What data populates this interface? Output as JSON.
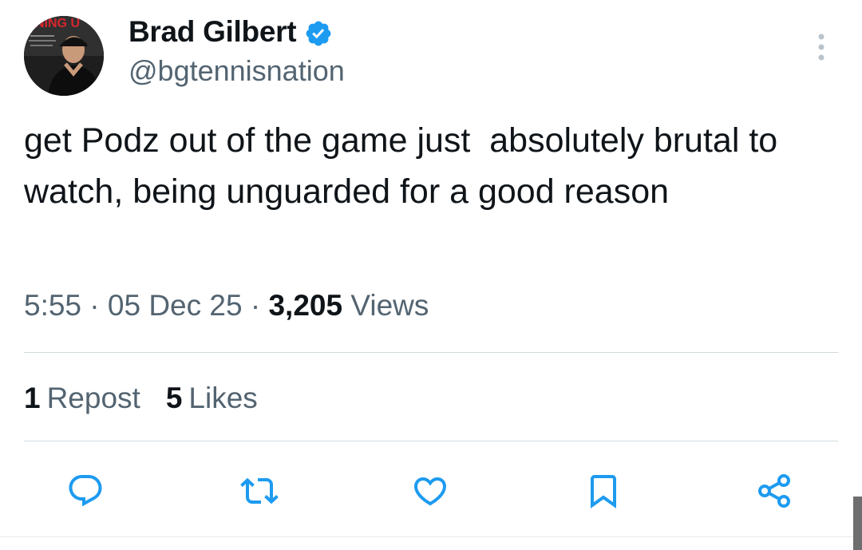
{
  "author": {
    "display_name": "Brad Gilbert",
    "handle": "@bgtennisnation",
    "verified": true,
    "avatar_banner_text": "INNING U"
  },
  "tweet": {
    "text": "get Podz out of the game just  absolutely brutal to watch, being unguarded for a good reason",
    "time": "5:55",
    "separator": " · ",
    "date": "05 Dec 25",
    "views_count": "3,205",
    "views_label": "Views"
  },
  "stats": {
    "reposts_count": "1",
    "reposts_label": "Repost",
    "likes_count": "5",
    "likes_label": "Likes"
  },
  "colors": {
    "text_primary": "#0f1419",
    "text_secondary": "#536471",
    "verified_blue": "#1d9bf0",
    "divider": "#cfd9de"
  },
  "icons": {
    "reply": "reply-icon",
    "repost": "repost-icon",
    "like": "like-icon",
    "bookmark": "bookmark-icon",
    "share": "share-icon",
    "more": "more-options-icon",
    "verified": "verified-badge-icon"
  }
}
